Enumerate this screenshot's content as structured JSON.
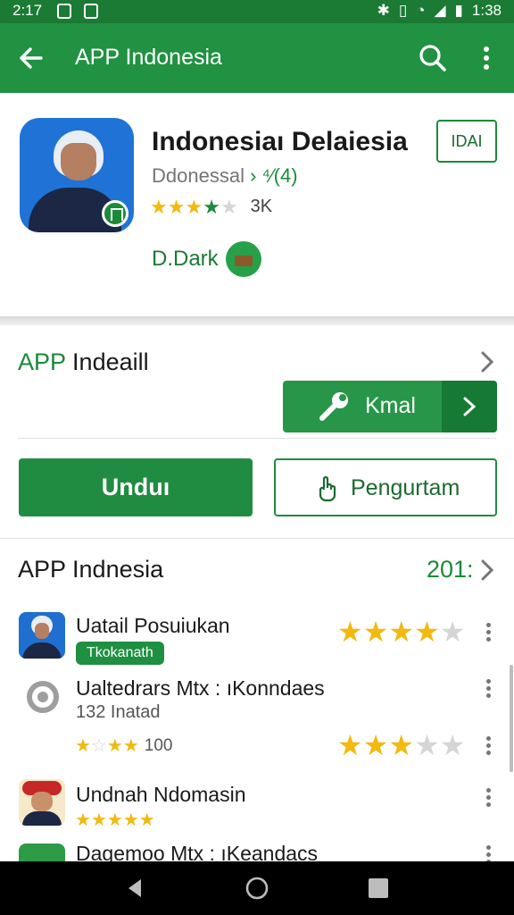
{
  "status_bar": {
    "time": "2:17",
    "clock": "1:38"
  },
  "app_bar": {
    "title": "APP Indonesia"
  },
  "app": {
    "name": "Indonesiaı Delaiesia",
    "subtitle": "Ddonessal",
    "subtitle_extra": "› ⁴⁄(4)",
    "rating_stars": 3.5,
    "rating_count": "3K",
    "developer": "D.Dark",
    "id_button": "IDAI"
  },
  "section_install": {
    "title_prefix": "APP",
    "title_rest": " Indeaill",
    "kmal_label": "Kmal",
    "download_label": "Unduı",
    "manage_label": "Pengurtam"
  },
  "section_list": {
    "title": "APP Indnesia",
    "count": "201:",
    "items": [
      {
        "title": "Uatail Posuiukan",
        "tag": "Tkokanath",
        "stars": 4.5
      },
      {
        "title": "Ualtedrars Mtx : ‌ıKonndaes",
        "sub": "132 Inatad",
        "small_stars": 4,
        "small_count": "100",
        "stars": 3.5
      },
      {
        "title": "Undnah Ndomasin",
        "small_stars": 5
      },
      {
        "title": "Dagemoo Mtx : ‌ıKeandacs"
      }
    ]
  },
  "colors": {
    "primary": "#219142",
    "primary_dark": "#1b7a34",
    "star": "#f2b90f"
  }
}
